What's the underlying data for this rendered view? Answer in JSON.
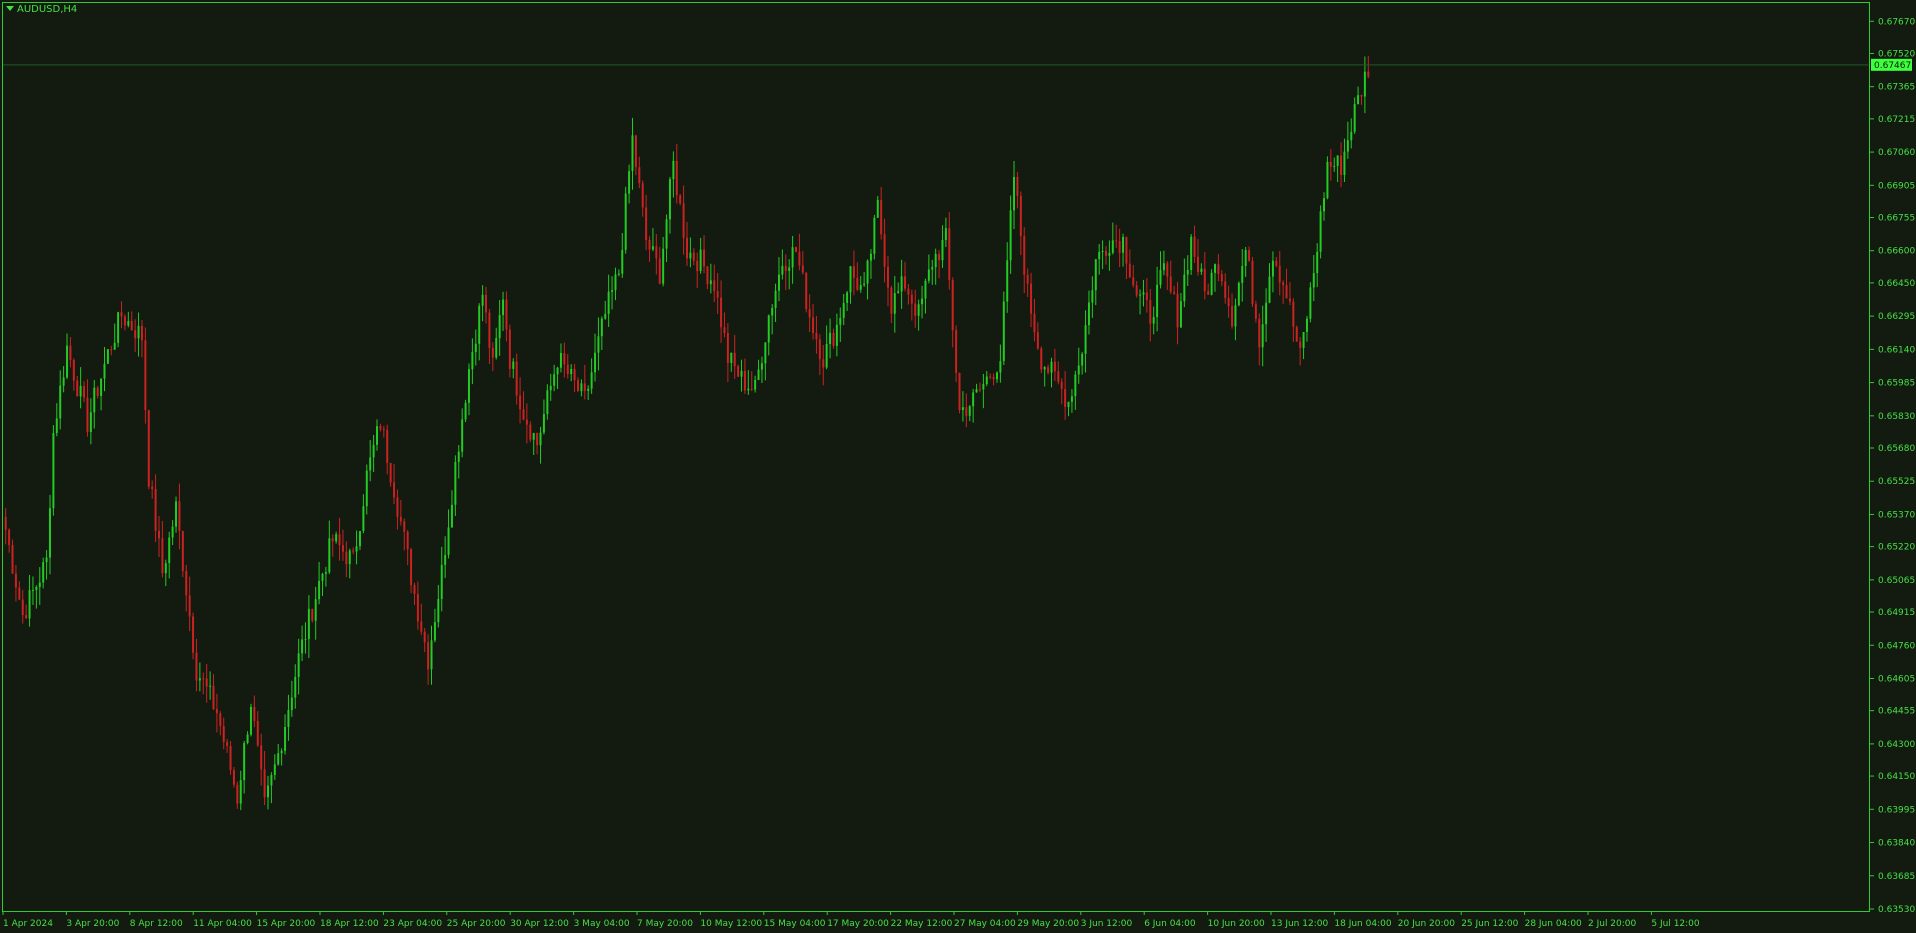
{
  "symbol": "AUDUSD,H4",
  "colors": {
    "background": "#131a10",
    "frame": "#2ecc2e",
    "text": "#46e046",
    "bull": "#22cc22",
    "bear": "#cc2222",
    "current_price_line": "#1f5a1f",
    "current_price_tag": "#3cff3c"
  },
  "chart_data": {
    "type": "candlestick",
    "timeframe": "H4",
    "grid": false,
    "y_axis_position": "right",
    "ylim": [
      0.6353,
      0.6769
    ],
    "y_ticks": [
      "0.67670",
      "0.67520",
      "0.67365",
      "0.67215",
      "0.67060",
      "0.66905",
      "0.66755",
      "0.66600",
      "0.66450",
      "0.66295",
      "0.66140",
      "0.65985",
      "0.65830",
      "0.65680",
      "0.65525",
      "0.65370",
      "0.65220",
      "0.65065",
      "0.64915",
      "0.64760",
      "0.64605",
      "0.64455",
      "0.64300",
      "0.64150",
      "0.63995",
      "0.63840",
      "0.63685",
      "0.63530"
    ],
    "x_ticks": [
      "1 Apr 2024",
      "3 Apr 20:00",
      "8 Apr 12:00",
      "11 Apr 04:00",
      "15 Apr 20:00",
      "18 Apr 12:00",
      "23 Apr 04:00",
      "25 Apr 20:00",
      "30 Apr 12:00",
      "3 May 04:00",
      "7 May 20:00",
      "10 May 12:00",
      "15 May 04:00",
      "17 May 20:00",
      "22 May 12:00",
      "27 May 04:00",
      "29 May 20:00",
      "3 Jun 12:00",
      "6 Jun 04:00",
      "10 Jun 20:00",
      "13 Jun 12:00",
      "18 Jun 04:00",
      "20 Jun 20:00",
      "25 Jun 12:00",
      "28 Jun 04:00",
      "2 Jul 20:00",
      "5 Jul 12:00"
    ],
    "current_price": "0.67467",
    "close_path": [
      [
        0,
        0.653
      ],
      [
        5,
        0.649
      ],
      [
        12,
        0.6515
      ],
      [
        14,
        0.6575
      ],
      [
        18,
        0.6615
      ],
      [
        24,
        0.658
      ],
      [
        30,
        0.6612
      ],
      [
        34,
        0.663
      ],
      [
        40,
        0.662
      ],
      [
        42,
        0.6555
      ],
      [
        46,
        0.651
      ],
      [
        50,
        0.654
      ],
      [
        56,
        0.6465
      ],
      [
        62,
        0.6445
      ],
      [
        68,
        0.6405
      ],
      [
        72,
        0.645
      ],
      [
        76,
        0.64
      ],
      [
        80,
        0.6425
      ],
      [
        86,
        0.647
      ],
      [
        92,
        0.6505
      ],
      [
        96,
        0.6525
      ],
      [
        102,
        0.6515
      ],
      [
        106,
        0.6555
      ],
      [
        110,
        0.658
      ],
      [
        114,
        0.655
      ],
      [
        120,
        0.65
      ],
      [
        124,
        0.647
      ],
      [
        128,
        0.651
      ],
      [
        132,
        0.656
      ],
      [
        136,
        0.6605
      ],
      [
        140,
        0.664
      ],
      [
        143,
        0.6605
      ],
      [
        146,
        0.664
      ],
      [
        148,
        0.661
      ],
      [
        152,
        0.6585
      ],
      [
        156,
        0.657
      ],
      [
        162,
        0.661
      ],
      [
        166,
        0.66
      ],
      [
        170,
        0.659
      ],
      [
        176,
        0.663
      ],
      [
        180,
        0.665
      ],
      [
        184,
        0.6712
      ],
      [
        188,
        0.6665
      ],
      [
        192,
        0.665
      ],
      [
        196,
        0.67
      ],
      [
        200,
        0.666
      ],
      [
        204,
        0.6655
      ],
      [
        208,
        0.6645
      ],
      [
        212,
        0.661
      ],
      [
        216,
        0.66
      ],
      [
        220,
        0.6595
      ],
      [
        224,
        0.663
      ],
      [
        228,
        0.6655
      ],
      [
        232,
        0.666
      ],
      [
        236,
        0.663
      ],
      [
        240,
        0.661
      ],
      [
        244,
        0.6625
      ],
      [
        248,
        0.665
      ],
      [
        252,
        0.664
      ],
      [
        256,
        0.668
      ],
      [
        260,
        0.6635
      ],
      [
        264,
        0.6645
      ],
      [
        268,
        0.663
      ],
      [
        272,
        0.6655
      ],
      [
        276,
        0.6665
      ],
      [
        280,
        0.6585
      ],
      [
        284,
        0.659
      ],
      [
        288,
        0.66
      ],
      [
        292,
        0.661
      ],
      [
        296,
        0.6695
      ],
      [
        300,
        0.664
      ],
      [
        304,
        0.661
      ],
      [
        308,
        0.66
      ],
      [
        312,
        0.659
      ],
      [
        316,
        0.6615
      ],
      [
        320,
        0.6655
      ],
      [
        324,
        0.6665
      ],
      [
        328,
        0.6665
      ],
      [
        332,
        0.664
      ],
      [
        336,
        0.663
      ],
      [
        340,
        0.665
      ],
      [
        344,
        0.663
      ],
      [
        348,
        0.6665
      ],
      [
        352,
        0.664
      ],
      [
        356,
        0.6655
      ],
      [
        360,
        0.663
      ],
      [
        364,
        0.666
      ],
      [
        368,
        0.662
      ],
      [
        372,
        0.666
      ],
      [
        376,
        0.664
      ],
      [
        380,
        0.661
      ],
      [
        384,
        0.665
      ],
      [
        388,
        0.67
      ],
      [
        392,
        0.67
      ],
      [
        396,
        0.6725
      ],
      [
        400,
        0.6746
      ]
    ]
  }
}
